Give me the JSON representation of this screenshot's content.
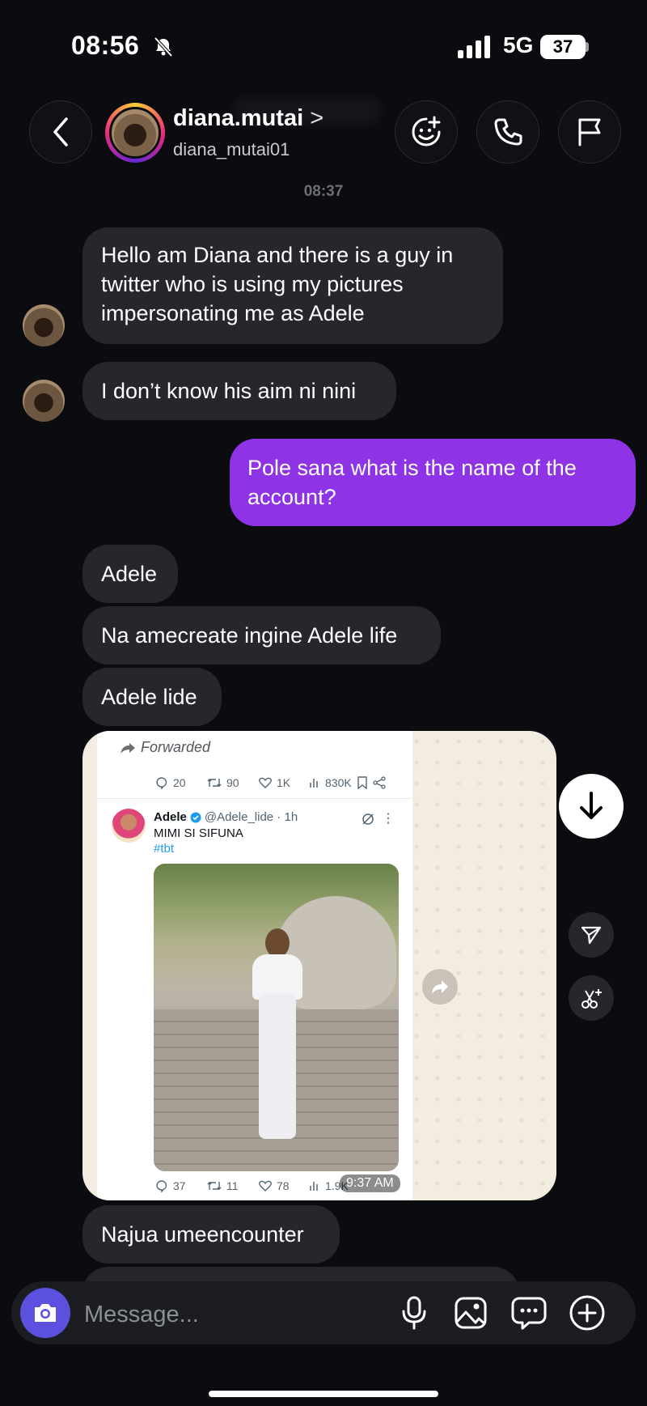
{
  "status_bar": {
    "time": "08:56",
    "network": "5G",
    "battery": "37"
  },
  "header": {
    "name": "diana.mutai",
    "chevron": ">",
    "handle": "diana_mutai01"
  },
  "timestamp": "08:37",
  "messages": [
    {
      "from": "them",
      "lines": [
        "Hello am Diana and there is a guy in",
        "twitter who is using my pictures",
        "impersonating me as Adele"
      ]
    },
    {
      "from": "them",
      "text": "I don’t know his aim ni nini"
    },
    {
      "from": "me",
      "lines": [
        "Pole sana  what is the name of the",
        "account?"
      ]
    },
    {
      "from": "them",
      "text": "Adele"
    },
    {
      "from": "them",
      "text": "Na amecreate ingine Adele life"
    },
    {
      "from": "them",
      "text": "Adele lide"
    },
    {
      "from": "them",
      "text": "Najua umeencounter"
    }
  ],
  "forwarded": {
    "label": "Forwarded",
    "top_stats": {
      "replies": "20",
      "retweets": "90",
      "likes": "1K",
      "views": "830K"
    },
    "author_name": "Adele",
    "author_handle": "@Adele_lide · 1h",
    "tweet_text": "MIMI SI SIFUNA",
    "hashtag": "#tbt",
    "bottom_stats": {
      "replies": "37",
      "retweets": "11",
      "likes": "78",
      "views": "1.9K"
    },
    "time": "9:37 AM"
  },
  "composer": {
    "placeholder": "Message..."
  },
  "icons": [
    "bell-slash-icon",
    "signal-icon",
    "back-icon",
    "sticker-add-icon",
    "phone-icon",
    "flag-icon",
    "arrow-down-icon",
    "send-icon",
    "scissors-sparkle-icon",
    "camera-icon",
    "mic-icon",
    "gallery-icon",
    "chat-bubble-icon",
    "plus-icon",
    "share-icon"
  ],
  "colors": {
    "background": "#0b0c0f",
    "bubble_them": "#26272c",
    "bubble_me": "#8e33e6",
    "camera": "#5b51de"
  }
}
